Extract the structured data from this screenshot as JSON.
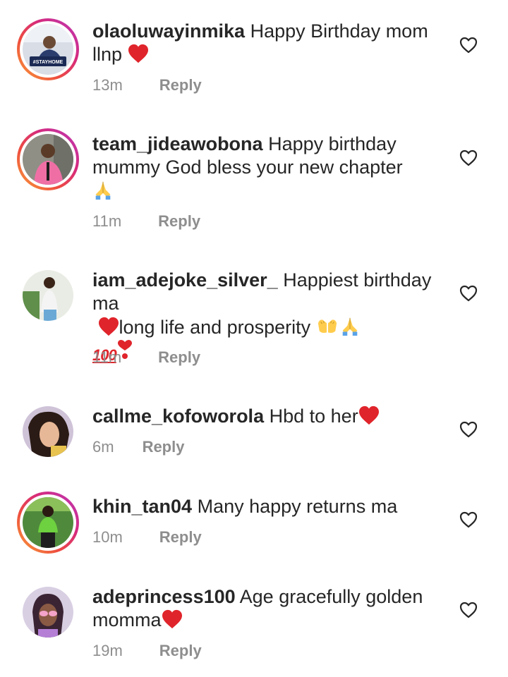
{
  "comments": [
    {
      "username": "olaoluwayinmika",
      "text": "Happy Birthday mom llnp",
      "emojis": [
        "red-heart"
      ],
      "time": "13m",
      "reply_label": "Reply",
      "story_ring": true
    },
    {
      "username": "team_jideawobona",
      "text": "Happy birthday mummy God bless your new chapter",
      "emojis": [
        "folded-hands"
      ],
      "time": "11m",
      "reply_label": "Reply",
      "story_ring": true
    },
    {
      "username": "iam_adejoke_silver_",
      "text": "Happiest birthday ma",
      "text2": "long life and prosperity",
      "emojis": [
        "red-heart",
        "palms-up-together",
        "folded-hands",
        "hundred-points",
        "red-heart"
      ],
      "time": "11m",
      "reply_label": "Reply",
      "story_ring": false
    },
    {
      "username": "callme_kofoworola",
      "text": "Hbd to her",
      "emojis": [
        "red-heart"
      ],
      "time": "6m",
      "reply_label": "Reply",
      "story_ring": false
    },
    {
      "username": "khin_tan04",
      "text": "Many happy returns ma",
      "emojis": [],
      "time": "10m",
      "reply_label": "Reply",
      "story_ring": true
    },
    {
      "username": "adeprincess100",
      "text": "Age gracefully golden momma",
      "emojis": [
        "red-heart"
      ],
      "time": "19m",
      "reply_label": "Reply",
      "story_ring": false
    }
  ],
  "emoji_text": {
    "hundred": "100"
  },
  "colors": {
    "text": "#262626",
    "meta": "#8e8e8e",
    "heart": "#e0242b",
    "ring_start": "#f9a23a",
    "ring_end": "#b93ab9"
  }
}
